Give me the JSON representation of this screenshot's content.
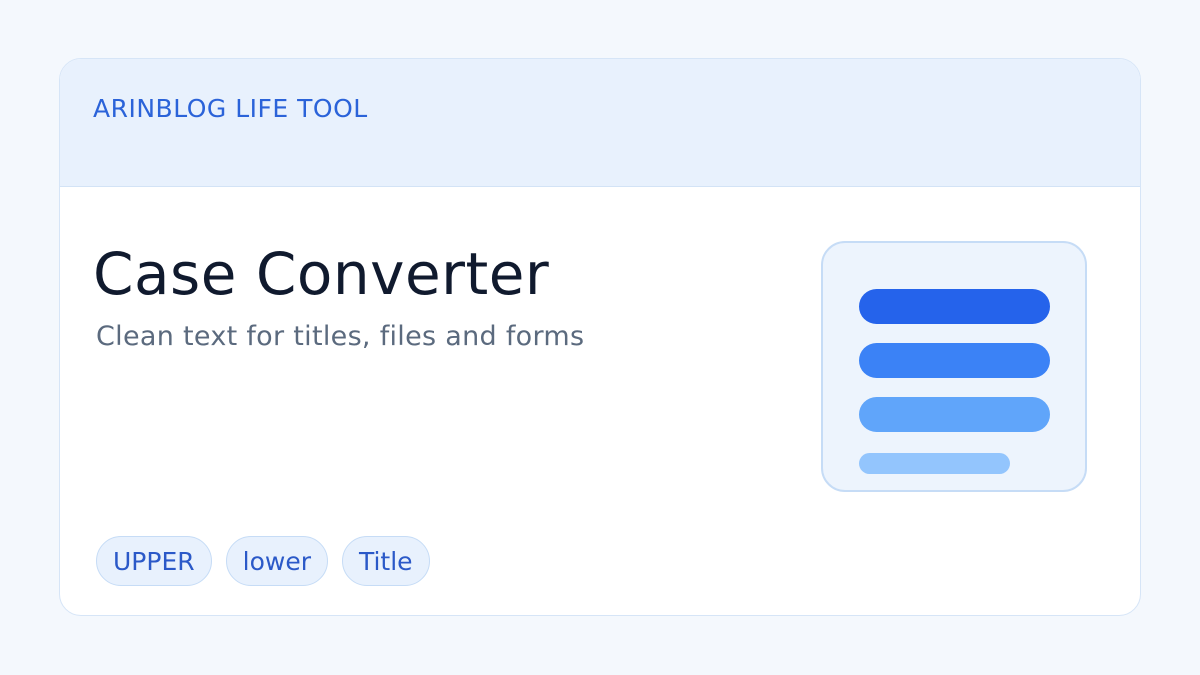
{
  "header": {
    "brand": "ARINBLOG LIFE TOOL"
  },
  "main": {
    "title": "Case Converter",
    "subtitle": "Clean text for titles, files and forms"
  },
  "tags": [
    "UPPER",
    "lower",
    "Title"
  ],
  "colors": {
    "accent": "#2563eb",
    "bar_1": "#2563eb",
    "bar_2": "#3b82f6",
    "bar_3": "#60a5fa",
    "bar_4": "#93c5fd"
  },
  "icon": "text-lines-icon"
}
